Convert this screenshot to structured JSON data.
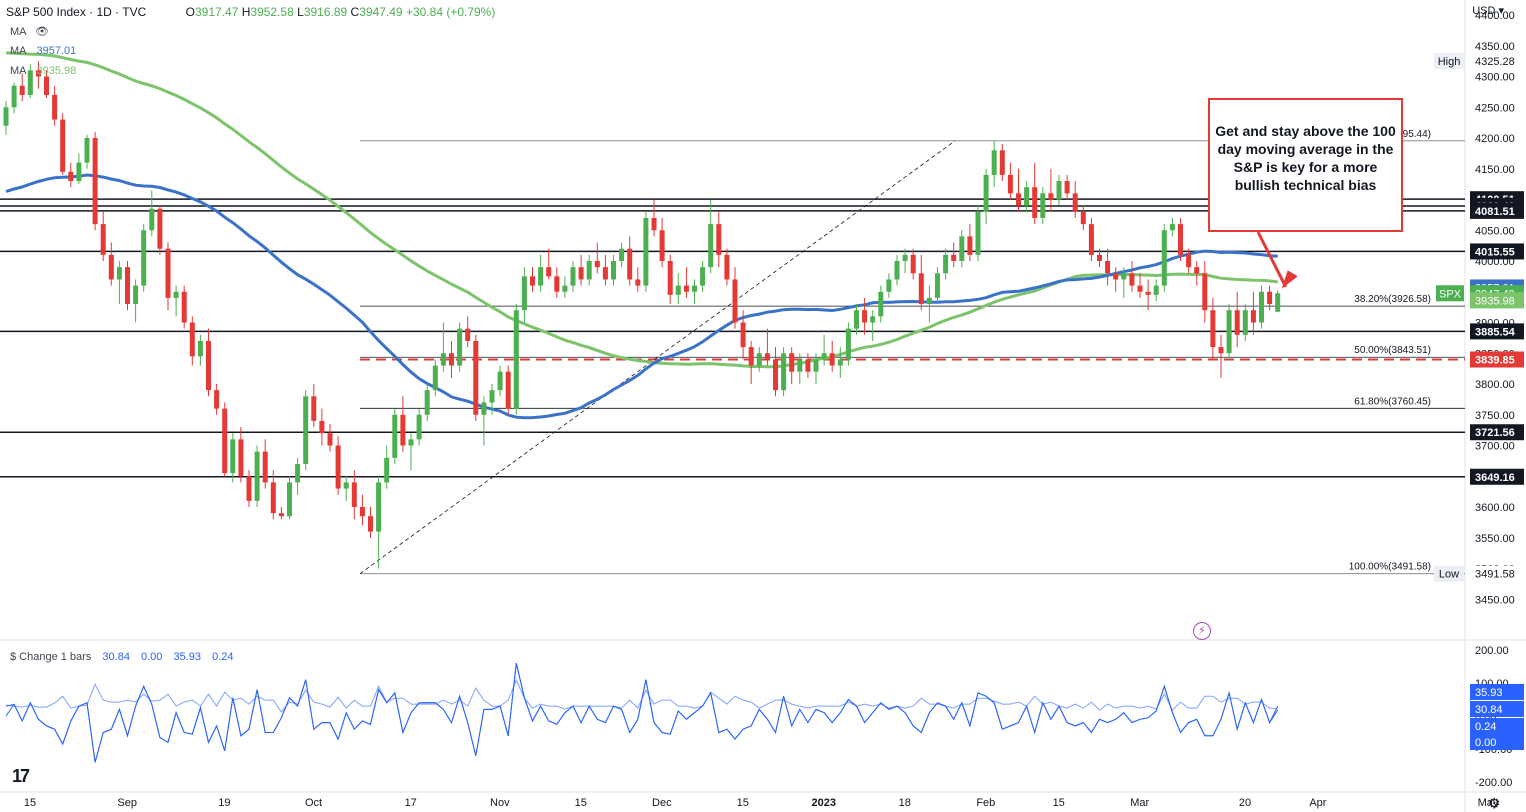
{
  "header": {
    "symbol": "S&P 500 Index · 1D · TVC",
    "open": "3917.47",
    "high": "3952.58",
    "low": "3916.89",
    "close": "3947.49",
    "change": "+30.84 (+0.79%)",
    "ma_blank": "MA",
    "ma1_label": "MA",
    "ma1_value": "3957.01",
    "ma2_label": "MA",
    "ma2_value": "3935.98"
  },
  "currency": "USD",
  "callout_text": "Get and stay above the 100 day moving average in the S&P is key for a more bullish technical bias",
  "colors": {
    "up": "#4caf50",
    "down": "#e53935",
    "ma100": "#3a72c8",
    "ma200": "#7dc36b",
    "osc": "#2962ff",
    "callout": "#e53935"
  },
  "chart_data": {
    "type": "candlestick",
    "price_axis": {
      "min": 3400,
      "max": 4400,
      "ticks": [
        3450,
        3500,
        3550,
        3600,
        3650,
        3700,
        3750,
        3800,
        3850,
        3900,
        3950,
        4000,
        4050,
        4100,
        4150,
        4200,
        4250,
        4300,
        4350,
        4400
      ]
    },
    "time_axis": {
      "labels": [
        {
          "label": "15",
          "i": 0
        },
        {
          "label": "Sep",
          "i": 12
        },
        {
          "label": "19",
          "i": 24
        },
        {
          "label": "Oct",
          "i": 35
        },
        {
          "label": "17",
          "i": 47
        },
        {
          "label": "Nov",
          "i": 58
        },
        {
          "label": "15",
          "i": 68
        },
        {
          "label": "Dec",
          "i": 78
        },
        {
          "label": "15",
          "i": 88
        },
        {
          "label": "2023",
          "i": 98
        },
        {
          "label": "18",
          "i": 108
        },
        {
          "label": "Feb",
          "i": 118
        },
        {
          "label": "15",
          "i": 127
        },
        {
          "label": "Mar",
          "i": 137
        },
        {
          "label": "20",
          "i": 150
        },
        {
          "label": "Apr",
          "i": 159
        },
        {
          "label": "May",
          "i": 180
        }
      ]
    },
    "candles": [
      [
        4220,
        4260,
        4205,
        4250
      ],
      [
        4250,
        4290,
        4240,
        4285
      ],
      [
        4285,
        4305,
        4260,
        4270
      ],
      [
        4270,
        4320,
        4265,
        4310
      ],
      [
        4310,
        4325,
        4280,
        4300
      ],
      [
        4300,
        4310,
        4265,
        4270
      ],
      [
        4270,
        4285,
        4220,
        4230
      ],
      [
        4230,
        4240,
        4140,
        4145
      ],
      [
        4145,
        4160,
        4120,
        4130
      ],
      [
        4130,
        4175,
        4125,
        4160
      ],
      [
        4160,
        4205,
        4150,
        4200
      ],
      [
        4200,
        4210,
        4050,
        4060
      ],
      [
        4060,
        4080,
        4000,
        4010
      ],
      [
        4010,
        4030,
        3960,
        3970
      ],
      [
        3970,
        4000,
        3930,
        3990
      ],
      [
        3990,
        4000,
        3920,
        3930
      ],
      [
        3930,
        3970,
        3900,
        3960
      ],
      [
        3960,
        4060,
        3950,
        4050
      ],
      [
        4050,
        4115,
        4040,
        4085
      ],
      [
        4085,
        4090,
        4010,
        4020
      ],
      [
        4020,
        4030,
        3920,
        3940
      ],
      [
        3940,
        3960,
        3910,
        3950
      ],
      [
        3950,
        3960,
        3890,
        3900
      ],
      [
        3900,
        3910,
        3830,
        3845
      ],
      [
        3845,
        3880,
        3830,
        3870
      ],
      [
        3870,
        3890,
        3780,
        3790
      ],
      [
        3790,
        3800,
        3750,
        3760
      ],
      [
        3760,
        3770,
        3650,
        3655
      ],
      [
        3655,
        3720,
        3640,
        3710
      ],
      [
        3710,
        3730,
        3640,
        3650
      ],
      [
        3650,
        3660,
        3600,
        3610
      ],
      [
        3610,
        3700,
        3600,
        3690
      ],
      [
        3690,
        3710,
        3630,
        3640
      ],
      [
        3640,
        3660,
        3580,
        3590
      ],
      [
        3590,
        3600,
        3580,
        3585
      ],
      [
        3585,
        3650,
        3580,
        3640
      ],
      [
        3640,
        3680,
        3620,
        3670
      ],
      [
        3670,
        3790,
        3660,
        3780
      ],
      [
        3780,
        3800,
        3730,
        3740
      ],
      [
        3740,
        3760,
        3700,
        3720
      ],
      [
        3720,
        3735,
        3690,
        3700
      ],
      [
        3700,
        3715,
        3620,
        3630
      ],
      [
        3630,
        3650,
        3610,
        3640
      ],
      [
        3640,
        3660,
        3580,
        3600
      ],
      [
        3600,
        3620,
        3570,
        3585
      ],
      [
        3585,
        3600,
        3550,
        3560
      ],
      [
        3560,
        3650,
        3500,
        3640
      ],
      [
        3640,
        3700,
        3630,
        3680
      ],
      [
        3680,
        3760,
        3670,
        3750
      ],
      [
        3750,
        3780,
        3690,
        3700
      ],
      [
        3700,
        3720,
        3660,
        3710
      ],
      [
        3710,
        3760,
        3700,
        3750
      ],
      [
        3750,
        3800,
        3740,
        3790
      ],
      [
        3790,
        3840,
        3780,
        3830
      ],
      [
        3830,
        3900,
        3820,
        3850
      ],
      [
        3850,
        3870,
        3810,
        3830
      ],
      [
        3830,
        3900,
        3820,
        3890
      ],
      [
        3890,
        3910,
        3860,
        3870
      ],
      [
        3870,
        3880,
        3740,
        3750
      ],
      [
        3750,
        3780,
        3700,
        3770
      ],
      [
        3770,
        3800,
        3750,
        3790
      ],
      [
        3790,
        3830,
        3780,
        3820
      ],
      [
        3820,
        3830,
        3750,
        3760
      ],
      [
        3760,
        3930,
        3750,
        3920
      ],
      [
        3920,
        3990,
        3900,
        3975
      ],
      [
        3975,
        3990,
        3950,
        3960
      ],
      [
        3960,
        4010,
        3950,
        3990
      ],
      [
        3990,
        4020,
        3970,
        3975
      ],
      [
        3975,
        3990,
        3940,
        3950
      ],
      [
        3950,
        3975,
        3940,
        3960
      ],
      [
        3960,
        4000,
        3950,
        3990
      ],
      [
        3990,
        4010,
        3960,
        3970
      ],
      [
        3970,
        4010,
        3960,
        4000
      ],
      [
        4000,
        4030,
        3980,
        3990
      ],
      [
        3990,
        4010,
        3960,
        3970
      ],
      [
        3970,
        4010,
        3960,
        4000
      ],
      [
        4000,
        4030,
        3990,
        4020
      ],
      [
        4020,
        4040,
        3960,
        3970
      ],
      [
        3970,
        3990,
        3950,
        3960
      ],
      [
        3960,
        4080,
        3950,
        4070
      ],
      [
        4070,
        4100,
        4040,
        4050
      ],
      [
        4050,
        4070,
        3990,
        4000
      ],
      [
        4000,
        4010,
        3930,
        3945
      ],
      [
        3945,
        3980,
        3930,
        3960
      ],
      [
        3960,
        3990,
        3940,
        3950
      ],
      [
        3950,
        3970,
        3930,
        3960
      ],
      [
        3960,
        4000,
        3950,
        3990
      ],
      [
        3990,
        4100,
        3980,
        4060
      ],
      [
        4060,
        4080,
        3990,
        4010
      ],
      [
        4010,
        4020,
        3960,
        3970
      ],
      [
        3970,
        3990,
        3890,
        3900
      ],
      [
        3900,
        3920,
        3840,
        3860
      ],
      [
        3860,
        3870,
        3800,
        3830
      ],
      [
        3830,
        3860,
        3820,
        3850
      ],
      [
        3850,
        3890,
        3830,
        3840
      ],
      [
        3840,
        3860,
        3780,
        3790
      ],
      [
        3790,
        3860,
        3780,
        3850
      ],
      [
        3850,
        3860,
        3800,
        3820
      ],
      [
        3820,
        3850,
        3800,
        3840
      ],
      [
        3840,
        3850,
        3810,
        3820
      ],
      [
        3820,
        3850,
        3800,
        3840
      ],
      [
        3840,
        3880,
        3830,
        3850
      ],
      [
        3850,
        3870,
        3820,
        3830
      ],
      [
        3830,
        3860,
        3810,
        3840
      ],
      [
        3840,
        3900,
        3830,
        3890
      ],
      [
        3890,
        3930,
        3880,
        3920
      ],
      [
        3920,
        3940,
        3880,
        3900
      ],
      [
        3900,
        3920,
        3870,
        3910
      ],
      [
        3910,
        3960,
        3900,
        3950
      ],
      [
        3950,
        3980,
        3940,
        3970
      ],
      [
        3970,
        4010,
        3960,
        4000
      ],
      [
        4000,
        4020,
        3980,
        4010
      ],
      [
        4010,
        4020,
        3970,
        3980
      ],
      [
        3980,
        4010,
        3920,
        3930
      ],
      [
        3930,
        3960,
        3900,
        3940
      ],
      [
        3940,
        3990,
        3930,
        3980
      ],
      [
        3980,
        4020,
        3970,
        4010
      ],
      [
        4010,
        4030,
        3990,
        4000
      ],
      [
        4000,
        4050,
        3990,
        4040
      ],
      [
        4040,
        4060,
        4000,
        4010
      ],
      [
        4010,
        4090,
        4000,
        4080
      ],
      [
        4080,
        4150,
        4060,
        4140
      ],
      [
        4140,
        4195,
        4120,
        4180
      ],
      [
        4180,
        4190,
        4130,
        4140
      ],
      [
        4140,
        4160,
        4100,
        4110
      ],
      [
        4110,
        4150,
        4080,
        4090
      ],
      [
        4090,
        4130,
        4080,
        4120
      ],
      [
        4120,
        4160,
        4060,
        4070
      ],
      [
        4070,
        4120,
        4060,
        4110
      ],
      [
        4110,
        4150,
        4080,
        4100
      ],
      [
        4100,
        4140,
        4090,
        4130
      ],
      [
        4130,
        4140,
        4100,
        4110
      ],
      [
        4110,
        4130,
        4070,
        4080
      ],
      [
        4080,
        4090,
        4050,
        4060
      ],
      [
        4060,
        4070,
        4000,
        4010
      ],
      [
        4010,
        4020,
        3990,
        4000
      ],
      [
        4000,
        4020,
        3960,
        3980
      ],
      [
        3980,
        3990,
        3950,
        3970
      ],
      [
        3970,
        3990,
        3940,
        3980
      ],
      [
        3980,
        4000,
        3950,
        3960
      ],
      [
        3960,
        3980,
        3940,
        3950
      ],
      [
        3950,
        3970,
        3920,
        3945
      ],
      [
        3945,
        3970,
        3935,
        3960
      ],
      [
        3960,
        4060,
        3950,
        4050
      ],
      [
        4050,
        4070,
        4040,
        4060
      ],
      [
        4060,
        4070,
        4000,
        4010
      ],
      [
        4010,
        4020,
        3980,
        3990
      ],
      [
        3990,
        4000,
        3960,
        3980
      ],
      [
        3980,
        4000,
        3900,
        3920
      ],
      [
        3920,
        3940,
        3840,
        3860
      ],
      [
        3860,
        3880,
        3810,
        3850
      ],
      [
        3850,
        3930,
        3840,
        3920
      ],
      [
        3920,
        3950,
        3860,
        3880
      ],
      [
        3880,
        3930,
        3870,
        3920
      ],
      [
        3920,
        3950,
        3880,
        3900
      ],
      [
        3900,
        3960,
        3890,
        3950
      ],
      [
        3950,
        3960,
        3920,
        3930
      ],
      [
        3917.47,
        3952.58,
        3916.89,
        3947.49
      ]
    ],
    "ma_100": {
      "label": "MA",
      "color": "#3a72c8",
      "last": 3957.01
    },
    "ma_200": {
      "label": "MA",
      "color": "#7dc36b",
      "last": 3935.98
    },
    "horizontal_levels": [
      4100.51,
      4089.49,
      4081.51,
      4015.55,
      3885.54,
      3721.56,
      3649.16
    ],
    "support_line": 3839.85,
    "fibonacci": {
      "levels": [
        {
          "label": "100.00%(4195.44)",
          "price": 4195.44
        },
        {
          "label": "61.80%(3760.45)",
          "price": 3760.45
        },
        {
          "label": "50.00%(3843.51)",
          "price": 3843.51
        },
        {
          "label": "38.20%(3926.58)",
          "price": 3926.58
        },
        {
          "label": "100.00%(3491.58)",
          "price": 3491.58
        }
      ]
    },
    "price_labels": [
      {
        "text": "4325.28",
        "price": 4325.28,
        "kind": "high",
        "tag": "High"
      },
      {
        "text": "4100.51",
        "price": 4100.51,
        "kind": "black"
      },
      {
        "text": "4089.49",
        "price": 4089.49,
        "kind": "black"
      },
      {
        "text": "4081.51",
        "price": 4081.51,
        "kind": "black"
      },
      {
        "text": "4015.55",
        "price": 4015.55,
        "kind": "black"
      },
      {
        "text": "3957.01",
        "price": 3957.01,
        "kind": "blue"
      },
      {
        "text": "3947.49",
        "price": 3947.49,
        "kind": "green",
        "tag": "SPX"
      },
      {
        "text": "3935.98",
        "price": 3935.98,
        "kind": "lightgreen"
      },
      {
        "text": "3885.54",
        "price": 3885.54,
        "kind": "black"
      },
      {
        "text": "3839.85",
        "price": 3839.85,
        "kind": "red"
      },
      {
        "text": "3721.56",
        "price": 3721.56,
        "kind": "black"
      },
      {
        "text": "3649.16",
        "price": 3649.16,
        "kind": "black"
      },
      {
        "text": "3491.58",
        "price": 3491.58,
        "kind": "low",
        "tag": "Low"
      }
    ],
    "oscillator": {
      "title": "$ Change 1 bars",
      "values_text": [
        "30.84",
        "0.00",
        "35.93",
        "0.24"
      ],
      "axis_ticks": [
        200,
        100,
        0,
        -100,
        -200
      ],
      "range": [
        -230,
        230
      ],
      "labels": [
        "35.93",
        "30.84",
        "0.24",
        "0.00"
      ]
    }
  }
}
